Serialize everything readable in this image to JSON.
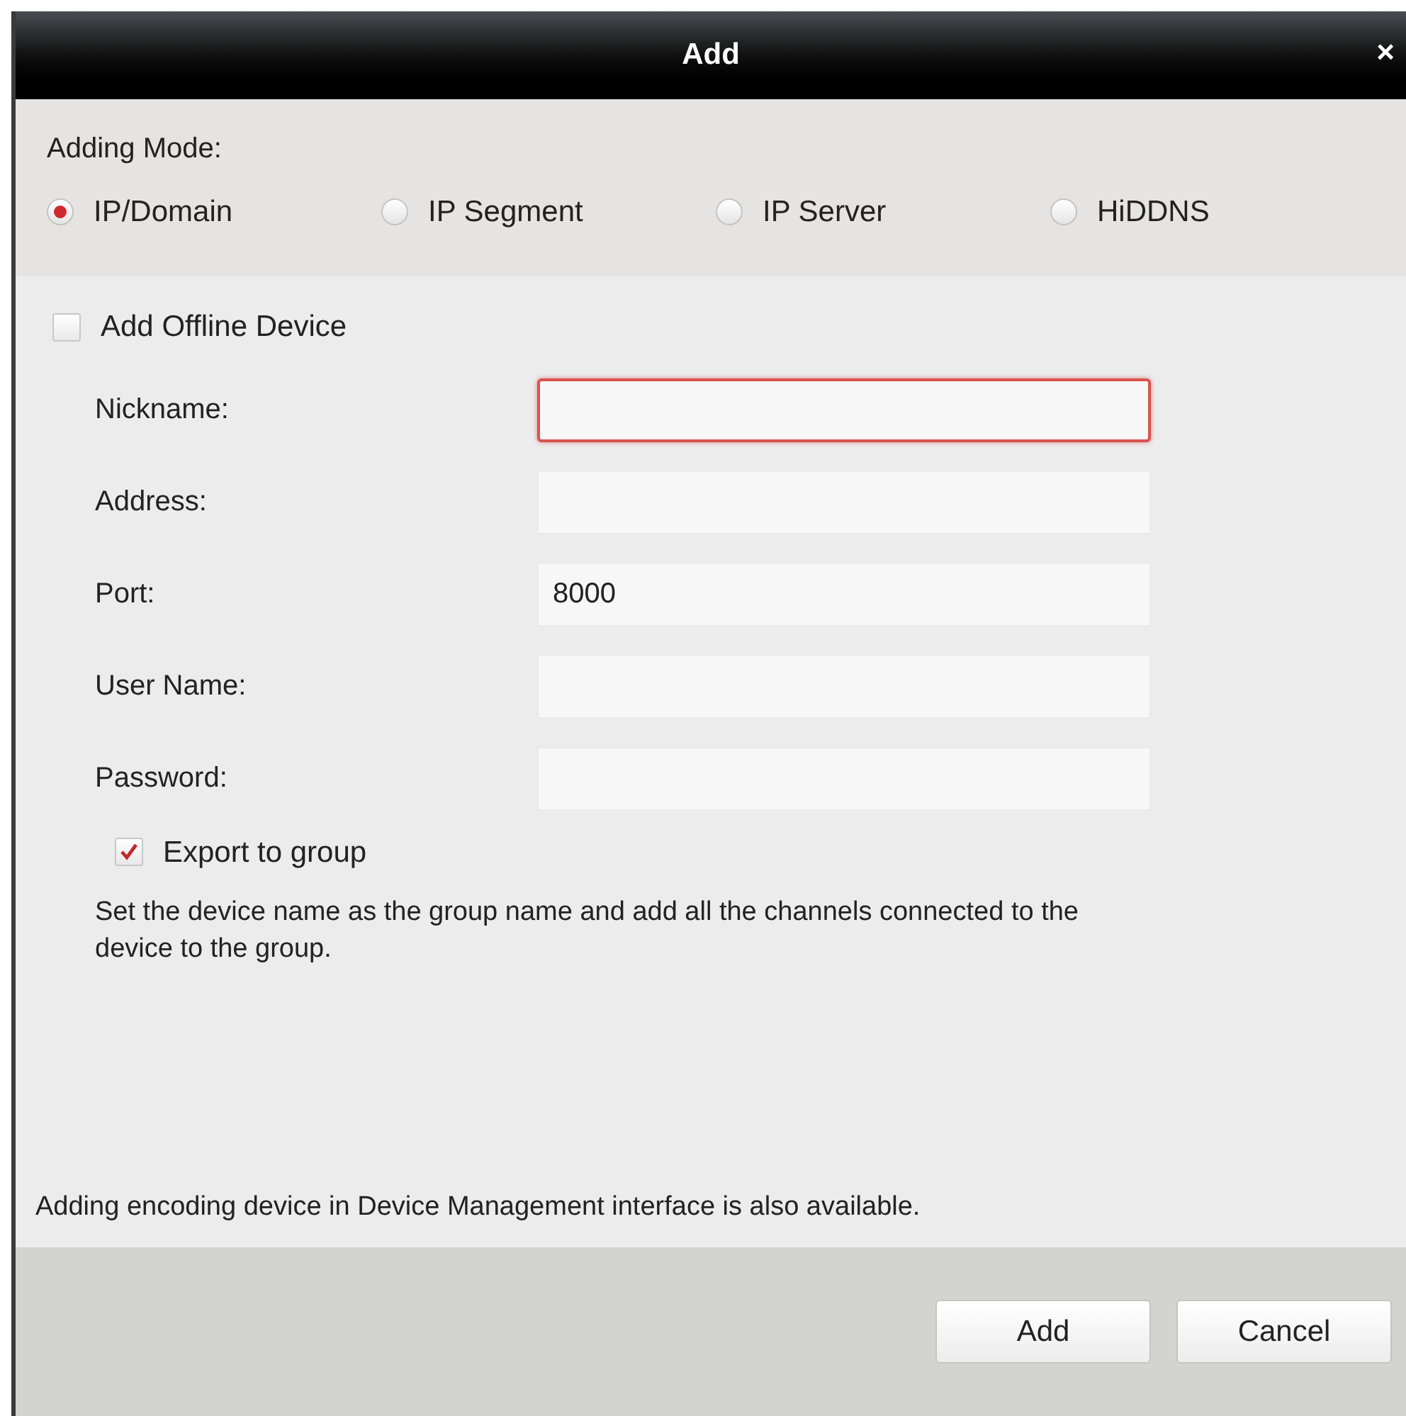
{
  "window": {
    "title": "Add",
    "close": "×"
  },
  "adding_mode": {
    "label": "Adding Mode:",
    "options": [
      {
        "label": "IP/Domain",
        "selected": true
      },
      {
        "label": "IP Segment",
        "selected": false
      },
      {
        "label": "IP Server",
        "selected": false
      },
      {
        "label": "HiDDNS",
        "selected": false
      }
    ]
  },
  "offline": {
    "label": "Add Offline Device",
    "checked": false
  },
  "fields": [
    {
      "label": "Nickname:",
      "focused": true
    },
    {
      "label": "Address:",
      "focused": false
    },
    {
      "label": "Port:",
      "value": "8000",
      "focused": false
    },
    {
      "label": "User Name:",
      "focused": false
    },
    {
      "label": "Password:",
      "focused": false
    }
  ],
  "export": {
    "label": "Export to group",
    "checked": true,
    "description": "Set the device name as the group name and add all the channels connected to the device to the group."
  },
  "note": "Adding encoding device in Device Management interface is also available.",
  "buttons": [
    "Add",
    "Cancel"
  ]
}
